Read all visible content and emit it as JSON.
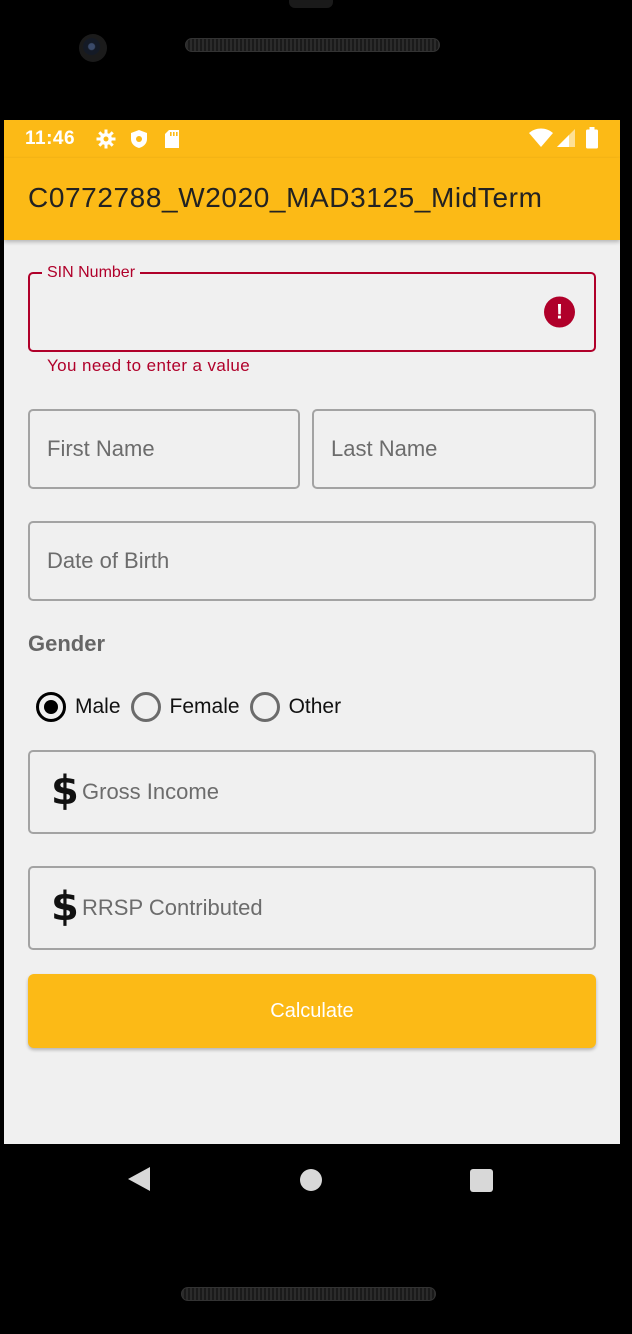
{
  "status_bar": {
    "time": "11:46"
  },
  "app_bar": {
    "title": "C0772788_W2020_MAD3125_MidTerm"
  },
  "form": {
    "sin": {
      "label": "SIN Number",
      "value": "",
      "error": "You need to enter a value"
    },
    "first_name": {
      "placeholder": "First Name"
    },
    "last_name": {
      "placeholder": "Last Name"
    },
    "dob": {
      "placeholder": "Date of Birth"
    },
    "gender": {
      "label": "Gender",
      "options": [
        "Male",
        "Female",
        "Other"
      ],
      "selected": "Male"
    },
    "gross_income": {
      "prefix_icon": "dollar-icon",
      "placeholder": "Gross Income"
    },
    "rrsp": {
      "prefix_icon": "dollar-icon",
      "placeholder": "RRSP Contributed"
    },
    "calculate_label": "Calculate"
  },
  "colors": {
    "accent": "#fcba16",
    "error": "#b0002a",
    "background": "#f0f0f0"
  }
}
